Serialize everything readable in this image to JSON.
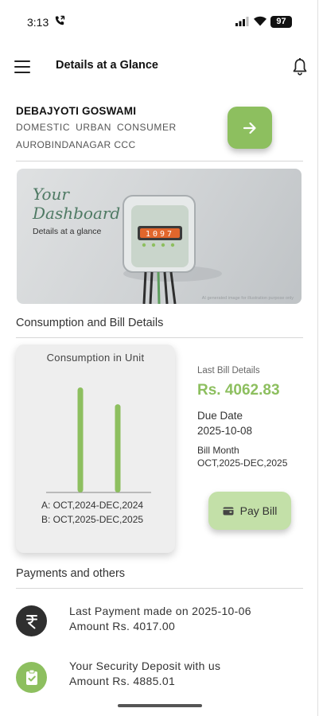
{
  "status_bar": {
    "time": "3:13",
    "battery": "97"
  },
  "app_bar": {
    "title": "Details at a Glance"
  },
  "consumer": {
    "name": "DEBAJYOTI GOSWAMI",
    "type": "DOMESTIC URBAN CONSUMER",
    "ccc": "AUROBINDANAGAR CCC"
  },
  "banner": {
    "heading_line1": "Your",
    "heading_line2": "Dashboard",
    "subtitle": "Details at a glance",
    "meter_digits": "1097",
    "credit": "AI generated image for illustration purpose only"
  },
  "sections": {
    "consumption": "Consumption and Bill Details",
    "payments": "Payments and others"
  },
  "chart_data": {
    "type": "bar",
    "title": "Consumption in Unit",
    "categories": [
      "A",
      "B"
    ],
    "values": [
      100,
      84
    ],
    "legend": [
      "A: OCT,2024-DEC,2024",
      "B: OCT,2025-DEC,2025"
    ],
    "bar_color": "#8dbf5f"
  },
  "last_bill": {
    "label": "Last Bill Details",
    "amount": "Rs. 4062.83",
    "due_label": "Due Date",
    "due_date": "2025-10-08",
    "month_label": "Bill Month",
    "month_value": "OCT,2025-DEC,2025",
    "pay_button": "Pay Bill"
  },
  "payments": [
    {
      "icon": "rupee-icon",
      "line1": "Last Payment made on 2025-10-06",
      "line2": "Amount Rs. 4017.00"
    },
    {
      "icon": "clipboard-check-icon",
      "line1": "Your Security Deposit with us",
      "line2": "Amount Rs. 4885.01"
    }
  ],
  "colors": {
    "accent_green": "#8dbf5f",
    "light_green": "#c3e0a8",
    "dark_icon_bg": "#2f2f2f"
  }
}
